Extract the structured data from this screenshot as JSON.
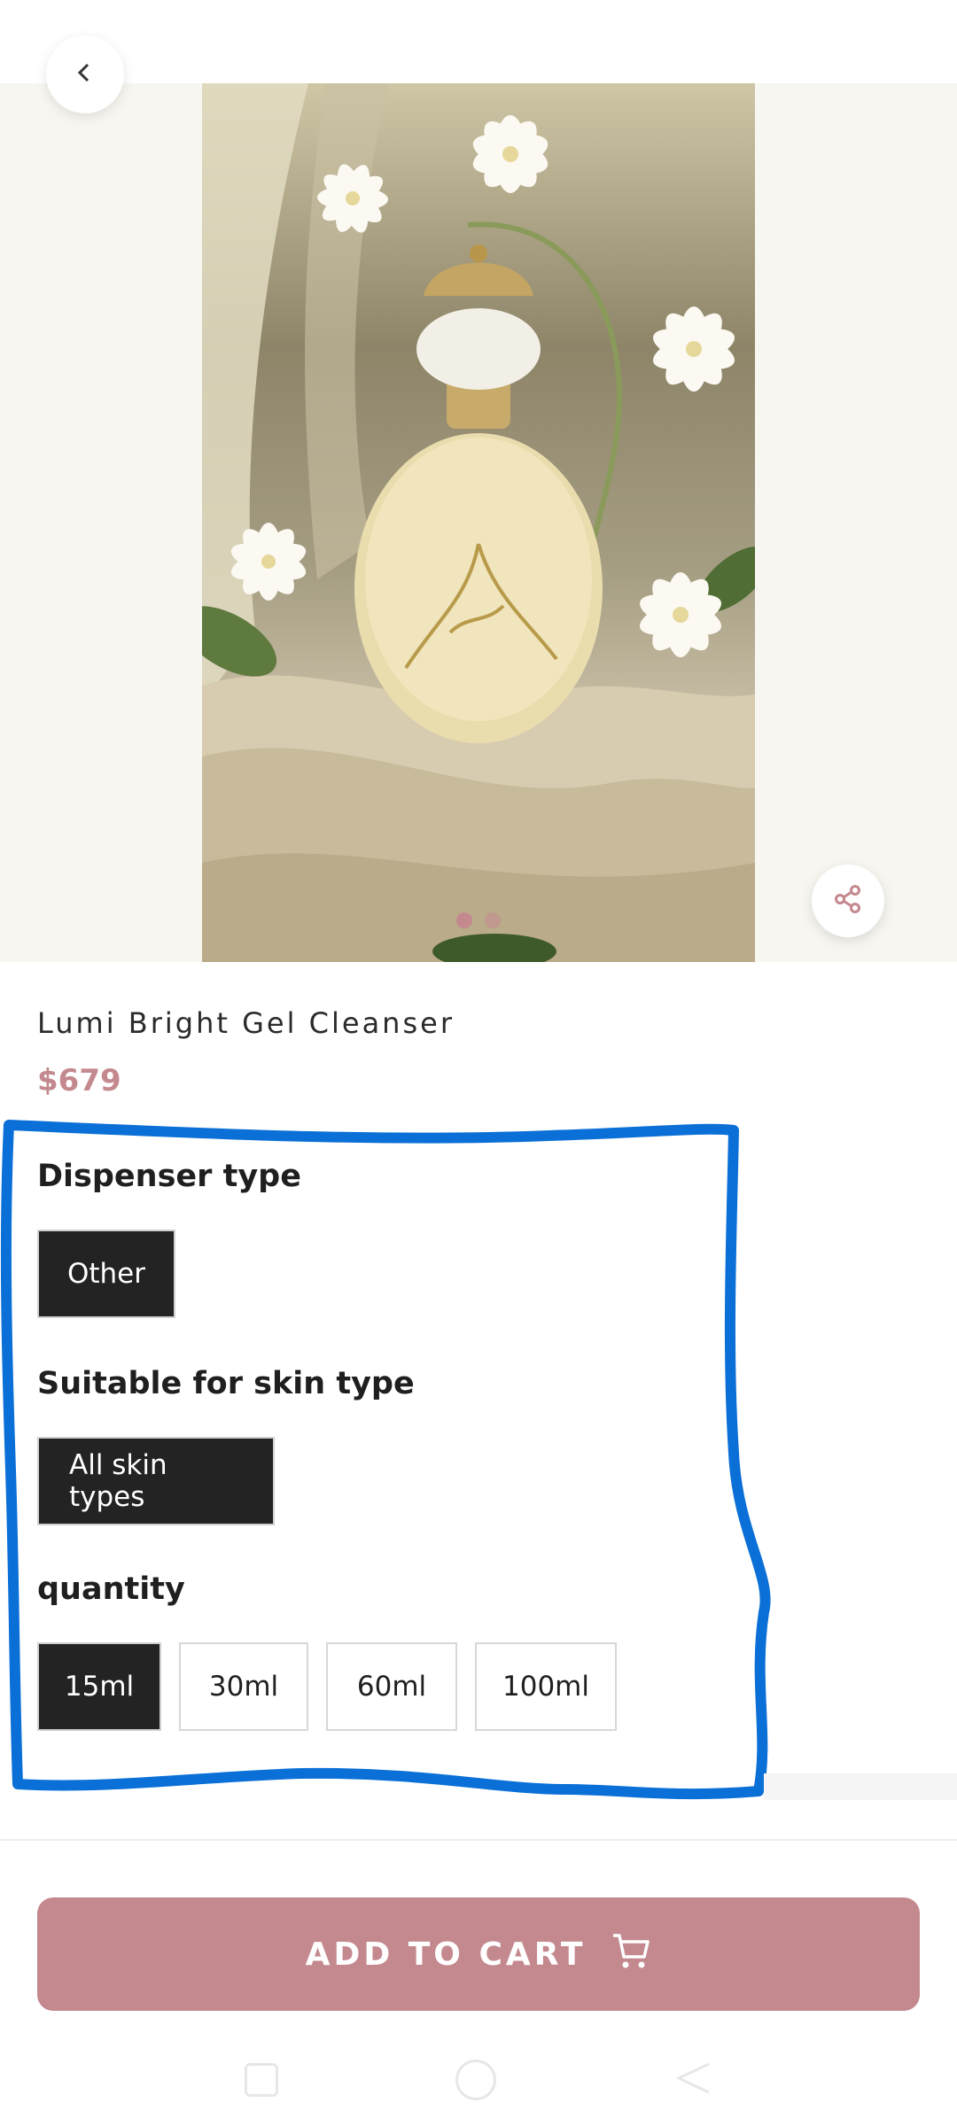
{
  "header": {
    "back_icon": "chevron-left-icon"
  },
  "gallery": {
    "image_subject": "perfume-bottle-with-white-flowers",
    "total_images": 2,
    "active_index": 0,
    "share_icon": "share-icon"
  },
  "product": {
    "title": "Lumi Bright Gel Cleanser",
    "price": "$679"
  },
  "options": {
    "dispenser": {
      "heading": "Dispenser type",
      "values": [
        "Other"
      ],
      "selected": "Other"
    },
    "skin": {
      "heading": "Suitable for skin type",
      "values": [
        "All skin types"
      ],
      "selected": "All skin types"
    },
    "quantity": {
      "heading": "quantity",
      "values": [
        "15ml",
        "30ml",
        "60ml",
        "100ml"
      ],
      "selected": "15ml"
    }
  },
  "cart": {
    "label": "ADD TO CART",
    "icon": "cart-icon"
  },
  "colors": {
    "accent": "#c4898f",
    "selected_option_bg": "#232323",
    "annotation_stroke": "#0a6fd6"
  },
  "system_nav": {
    "icons": [
      "recents-icon",
      "home-icon",
      "back-icon"
    ]
  }
}
